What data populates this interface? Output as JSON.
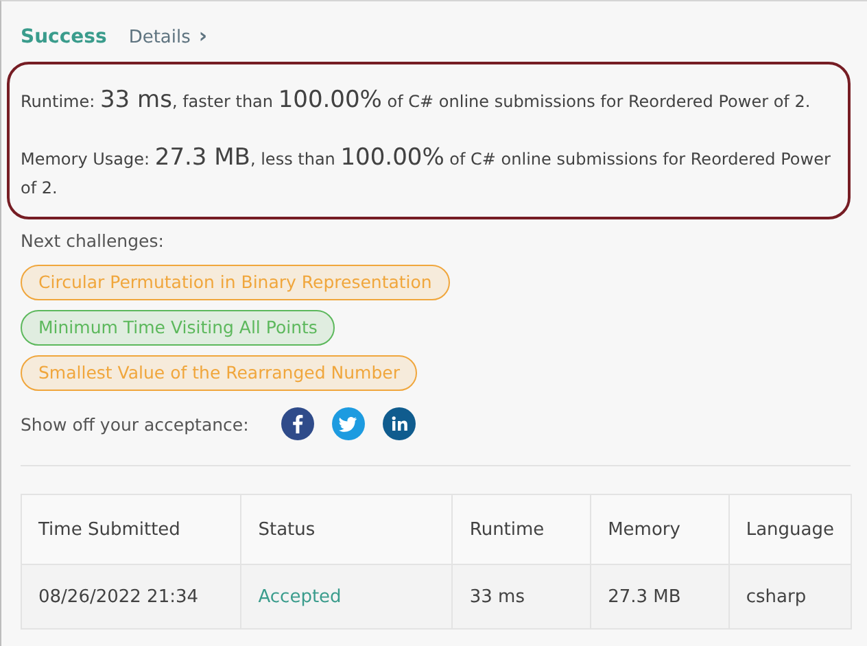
{
  "header": {
    "title": "Success",
    "details_link": "Details",
    "details_caret": "›"
  },
  "stats": [
    {
      "parts": [
        {
          "kind": "plain",
          "text": "Runtime: "
        },
        {
          "kind": "big",
          "text": "33 ms"
        },
        {
          "kind": "plain",
          "text": ", faster than "
        },
        {
          "kind": "big",
          "text": "100.00%"
        },
        {
          "kind": "plain",
          "text": " of C# online submissions for Reordered Power of 2."
        }
      ]
    },
    {
      "parts": [
        {
          "kind": "plain",
          "text": "Memory Usage: "
        },
        {
          "kind": "big",
          "text": "27.3 MB"
        },
        {
          "kind": "plain",
          "text": ", less than "
        },
        {
          "kind": "big",
          "text": "100.00%"
        },
        {
          "kind": "plain",
          "text": " of C# online submissions for Reordered Power of 2."
        }
      ]
    }
  ],
  "next_challenges": {
    "label": "Next challenges:",
    "items": [
      {
        "title": "Circular Permutation in Binary Representation",
        "color": "#f0a63c"
      },
      {
        "title": "Minimum Time Visiting All Points",
        "color": "#5cb85c"
      },
      {
        "title": "Smallest Value of the Rearranged Number",
        "color": "#f0a63c"
      }
    ]
  },
  "share": {
    "label": "Show off your acceptance:",
    "networks": [
      {
        "kind": "facebook"
      },
      {
        "kind": "twitter"
      },
      {
        "kind": "linkedin"
      }
    ]
  },
  "table": {
    "columns": [
      "Time Submitted",
      "Status",
      "Runtime",
      "Memory",
      "Language"
    ],
    "rows": [
      {
        "cells": [
          "08/26/2022 21:34",
          "Accepted",
          "33 ms",
          "27.3 MB",
          "csharp"
        ],
        "accepted": true
      }
    ]
  }
}
